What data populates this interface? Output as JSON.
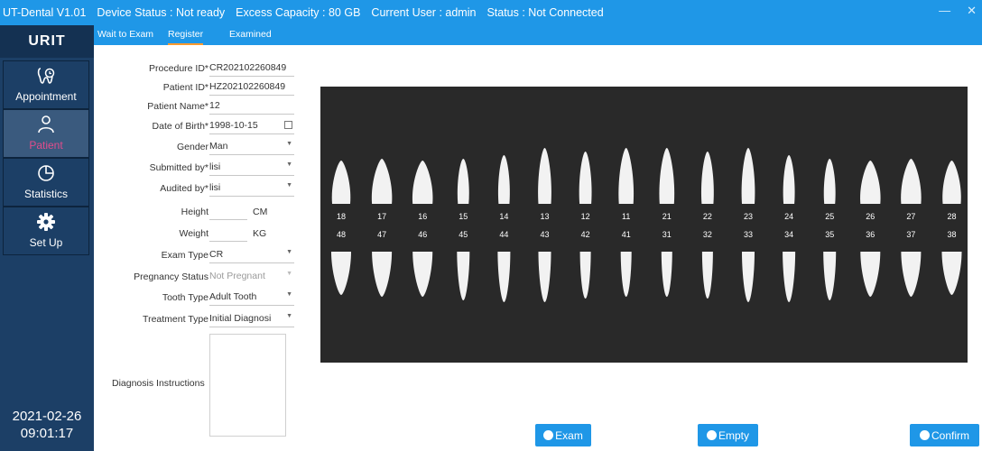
{
  "titlebar": {
    "app_name": "UT-Dental V1.01",
    "device_status": "Device Status : Not ready",
    "excess_capacity": "Excess Capacity : 80 GB",
    "current_user": "Current User : admin",
    "status": "Status : Not Connected",
    "minimize_label": "—",
    "close_label": "✕"
  },
  "sidebar": {
    "logo": "URIT",
    "items": [
      {
        "label": "Appointment",
        "icon": "tooth-clock-icon",
        "active": false
      },
      {
        "label": "Patient",
        "icon": "person-icon",
        "active": true
      },
      {
        "label": "Statistics",
        "icon": "pie-chart-icon",
        "active": false
      },
      {
        "label": "Set Up",
        "icon": "gear-icon",
        "active": false
      }
    ],
    "date": "2021-02-26",
    "time": "09:01:17"
  },
  "tabs": [
    {
      "label": "Wait to Exam",
      "active": false
    },
    {
      "label": "Register",
      "active": true
    },
    {
      "label": "Examined",
      "active": false
    }
  ],
  "form": {
    "procedure_id": {
      "label": "Procedure ID*",
      "value": "CR202102260849"
    },
    "patient_id": {
      "label": "Patient ID*",
      "value": "HZ202102260849"
    },
    "patient_name": {
      "label": "Patient Name*",
      "value": "12"
    },
    "date_of_birth": {
      "label": "Date of Birth*",
      "value": "1998-10-15"
    },
    "gender": {
      "label": "Gender",
      "value": "Man"
    },
    "submitted_by": {
      "label": "Submitted by*",
      "value": "lisi"
    },
    "audited_by": {
      "label": "Audited by*",
      "value": "lisi"
    },
    "height": {
      "label": "Height",
      "value": "",
      "unit": "CM"
    },
    "weight": {
      "label": "Weight",
      "value": "",
      "unit": "KG"
    },
    "exam_type": {
      "label": "Exam Type",
      "value": "CR"
    },
    "pregnancy_status": {
      "label": "Pregnancy Status",
      "value": "Not Pregnant"
    },
    "tooth_type": {
      "label": "Tooth Type",
      "value": "Adult Tooth"
    },
    "treatment_type": {
      "label": "Treatment Type",
      "value": "Initial Diagnosi"
    },
    "diagnosis_instructions": {
      "label": "Diagnosis Instructions",
      "value": ""
    }
  },
  "teeth": {
    "upper": [
      "18",
      "17",
      "16",
      "15",
      "14",
      "13",
      "12",
      "11",
      "21",
      "22",
      "23",
      "24",
      "25",
      "26",
      "27",
      "28"
    ],
    "lower": [
      "48",
      "47",
      "46",
      "45",
      "44",
      "43",
      "42",
      "41",
      "31",
      "32",
      "33",
      "34",
      "35",
      "36",
      "37",
      "38"
    ]
  },
  "buttons": {
    "exam": "Exam",
    "empty": "Empty",
    "confirm": "Confirm"
  },
  "colors": {
    "accent": "#1f97e7",
    "sidebar": "#1c3f66",
    "active_nav_text": "#e04d8c",
    "tab_underline": "#ff9a2e",
    "chart_bg": "#292929"
  }
}
